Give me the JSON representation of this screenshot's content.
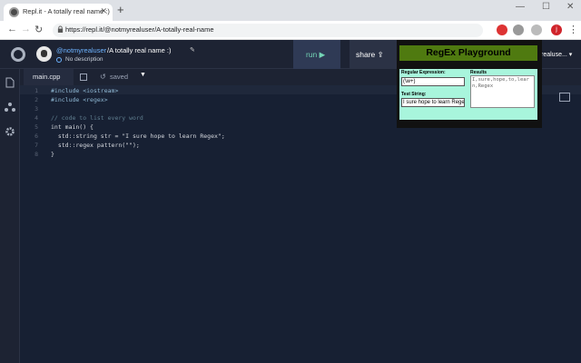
{
  "browser": {
    "tab_title": "Repl.it - A totally real name :)",
    "url": "https://repl.it/@notmyrealuser/A-totally-real-name",
    "profile_initial": "j"
  },
  "repl": {
    "username": "@notmyrealuser",
    "separator_name": "/A totally real name :)",
    "description": "No description",
    "run_label": "run",
    "share_label": "share",
    "user_chip": "realuse..."
  },
  "editor": {
    "file_tab": "main.cpp",
    "saved_label": "saved",
    "lines": [
      {
        "n": "1",
        "text": "#include <iostream>"
      },
      {
        "n": "2",
        "text": "#include <regex>"
      },
      {
        "n": "3",
        "text": ""
      },
      {
        "n": "4",
        "text": "// code to list every word"
      },
      {
        "n": "5",
        "text": "int main() {"
      },
      {
        "n": "6",
        "text": "  std::string str = \"I sure hope to learn Regex\";"
      },
      {
        "n": "7",
        "text": "  std::regex pattern(\"\");"
      },
      {
        "n": "8",
        "text": "}"
      }
    ]
  },
  "regex_popup": {
    "title": "RegEx Playground",
    "regex_label": "Regular Expression:",
    "regex_value": "(\\w+)",
    "test_label": "Test String:",
    "test_value": "I sure hope to learn Regex",
    "results_label": "Results",
    "results_value": "I,sure,hope,to,learn,Regex"
  }
}
